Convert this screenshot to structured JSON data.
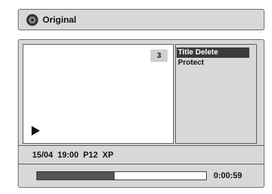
{
  "header": {
    "title": "Original",
    "icon": "disc-icon"
  },
  "preview": {
    "chapter_number": "3",
    "play_icon": "play-icon"
  },
  "menu": {
    "items": [
      {
        "label": "Title Delete",
        "selected": true
      },
      {
        "label": "Protect",
        "selected": false
      }
    ]
  },
  "info": {
    "text": "15/04  19:00  P12  XP"
  },
  "progress": {
    "fraction": 0.46,
    "time": "0:00:59"
  },
  "colors": {
    "panel": "#d8d8d8",
    "selected": "#3a3a3a",
    "progress_fill": "#555555"
  }
}
